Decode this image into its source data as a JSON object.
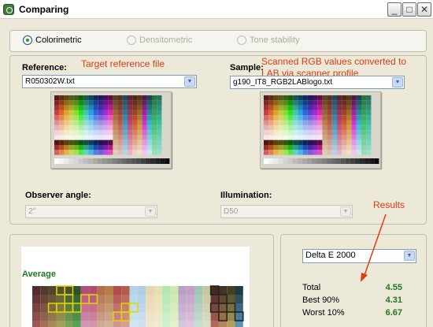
{
  "window": {
    "title": "Comparing"
  },
  "mode": {
    "options": [
      "Colorimetric",
      "Densitometric",
      "Tone stability"
    ],
    "selected": "Colorimetric"
  },
  "reference": {
    "label": "Reference:",
    "file": "R050302W.txt",
    "note": "Target reference file"
  },
  "sample": {
    "label": "Sample:",
    "file": "g190_IT8_RGB2LABlogo.txt",
    "note_line1": "Scanned RGB values converted to",
    "note_line2": "LAB via  scanner profile"
  },
  "observer": {
    "label": "Observer angle:",
    "value": "2°"
  },
  "illumination": {
    "label": "Illumination:",
    "value": "D50"
  },
  "results": {
    "note": "Results",
    "metric": "Delta E 2000",
    "average_label": "Average",
    "rows": [
      {
        "label": "Total",
        "value": "4.55"
      },
      {
        "label": "Best 90%",
        "value": "4.31"
      },
      {
        "label": "Worst 10%",
        "value": "6.67"
      }
    ]
  },
  "colors": {
    "annotation": "#e03a14",
    "value_green": "#1e7a1e"
  }
}
